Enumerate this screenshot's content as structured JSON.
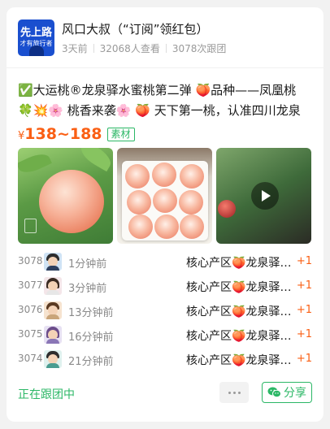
{
  "header": {
    "avatar_text_main": "先上路",
    "avatar_text_sub": "才有旅行者",
    "title": "风口大叔（“订阅”领红包）",
    "meta": [
      "3天前",
      "32068人查看",
      "3078次跟团"
    ]
  },
  "description": "✅大运桃®龙泉驿水蜜桃第二弹 🍑品种——凤凰桃 🍀💥🌸 桃香来袭🌸 🍑 天下第一桃，认准四川龙泉驿",
  "price": {
    "currency": "¥",
    "range": "138~188",
    "tag": "素材"
  },
  "gallery": [
    {
      "alt": "peach-on-tree"
    },
    {
      "alt": "boxed-peaches"
    },
    {
      "alt": "video-peach"
    }
  ],
  "orders": [
    {
      "num": "3078",
      "time": "1分钟前",
      "product": "核心产区🍑龙泉驿水蜜桃",
      "qty": "+1"
    },
    {
      "num": "3077",
      "time": "3分钟前",
      "product": "核心产区🍑龙泉驿水蜜桃",
      "qty": "+1"
    },
    {
      "num": "3076",
      "time": "13分钟前",
      "product": "核心产区🍑龙泉驿水蜜桃",
      "qty": "+1"
    },
    {
      "num": "3075",
      "time": "16分钟前",
      "product": "核心产区🍑龙泉驿水蜜桃",
      "qty": "+1"
    },
    {
      "num": "3074",
      "time": "21分钟前",
      "product": "核心产区🍑龙泉驿水蜜桃",
      "qty": "+1"
    }
  ],
  "footer": {
    "status": "正在跟团中",
    "share_label": "分享"
  },
  "colors": {
    "accent_green": "#2bb766",
    "price_orange": "#fa5f14"
  }
}
